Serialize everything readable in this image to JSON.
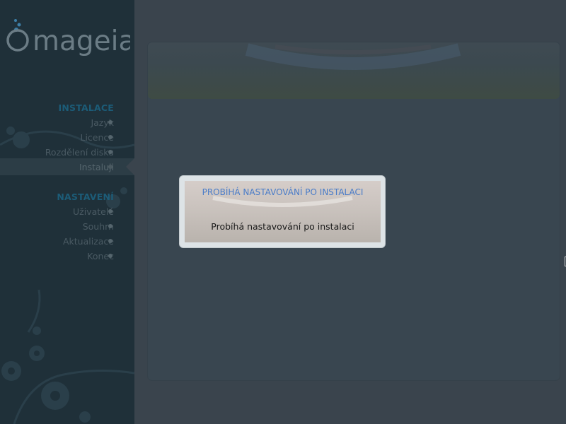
{
  "brand": {
    "logo_text": "mageia"
  },
  "sidebar": {
    "sections": [
      {
        "title": "INSTALACE",
        "steps": [
          "Jazyk",
          "Licence",
          "Rozdělení disku",
          "Instaluji"
        ]
      },
      {
        "title": "NASTAVENÍ",
        "steps": [
          "Uživatelé",
          "Souhrn",
          "Aktualizace",
          "Konec"
        ]
      }
    ],
    "active_step": "Instaluji"
  },
  "dialog": {
    "title": "PROBÍHÁ NASTAVOVÁNÍ PO INSTALACI",
    "message": "Probíhá nastavování po instalaci"
  },
  "colors": {
    "sidebar_bg": "#1f3039",
    "main_bg": "#3a444d",
    "section_heading": "#1c5c78",
    "dialog_title": "#4a7cc8"
  }
}
